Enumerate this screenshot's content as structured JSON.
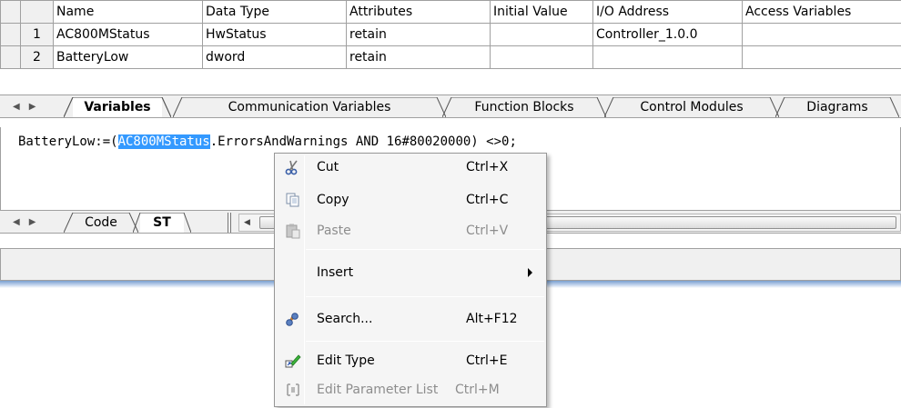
{
  "grid": {
    "columns": [
      "Name",
      "Data Type",
      "Attributes",
      "Initial Value",
      "I/O Address",
      "Access Variables"
    ],
    "rows": [
      {
        "num": "1",
        "name": "AC800MStatus",
        "type": "HwStatus",
        "attributes": "retain",
        "initial": "",
        "io": "Controller_1.0.0",
        "access": ""
      },
      {
        "num": "2",
        "name": "BatteryLow",
        "type": "dword",
        "attributes": "retain",
        "initial": "",
        "io": "",
        "access": ""
      }
    ]
  },
  "editor_tabs": [
    {
      "label": "Variables",
      "active": true
    },
    {
      "label": "Communication Variables",
      "active": false
    },
    {
      "label": "Function Blocks",
      "active": false
    },
    {
      "label": "Control Modules",
      "active": false
    },
    {
      "label": "Diagrams",
      "active": false
    }
  ],
  "code": {
    "prefix": "BatteryLow:=(",
    "selection": "AC800MStatus",
    "suffix": ".ErrorsAndWarnings AND 16#80020000) <>0;"
  },
  "code_tabs": [
    {
      "label": "Code",
      "active": false
    },
    {
      "label": "ST",
      "active": true
    }
  ],
  "context_menu": {
    "items": [
      {
        "label": "Cut",
        "shortcut": "Ctrl+X",
        "icon": "scissors-icon",
        "enabled": true
      },
      {
        "label": "Copy",
        "shortcut": "Ctrl+C",
        "icon": "copy-icon",
        "enabled": true
      },
      {
        "label": "Paste",
        "shortcut": "Ctrl+V",
        "icon": "paste-icon",
        "enabled": false
      },
      {
        "label": "Insert",
        "shortcut": "",
        "icon": "",
        "enabled": true,
        "submenu": true
      },
      {
        "label": "Search...",
        "shortcut": "Alt+F12",
        "icon": "search-binoculars-icon",
        "enabled": true
      },
      {
        "label": "Edit Type",
        "shortcut": "Ctrl+E",
        "icon": "edit-type-icon",
        "enabled": true
      },
      {
        "label": "Edit Parameter List",
        "shortcut": "Ctrl+M",
        "icon": "edit-parameter-list-icon",
        "enabled": false
      }
    ]
  },
  "colors": {
    "selection": "#3399ff",
    "menu_background": "#f5f5f5",
    "window_border": "#7aa0d0"
  }
}
